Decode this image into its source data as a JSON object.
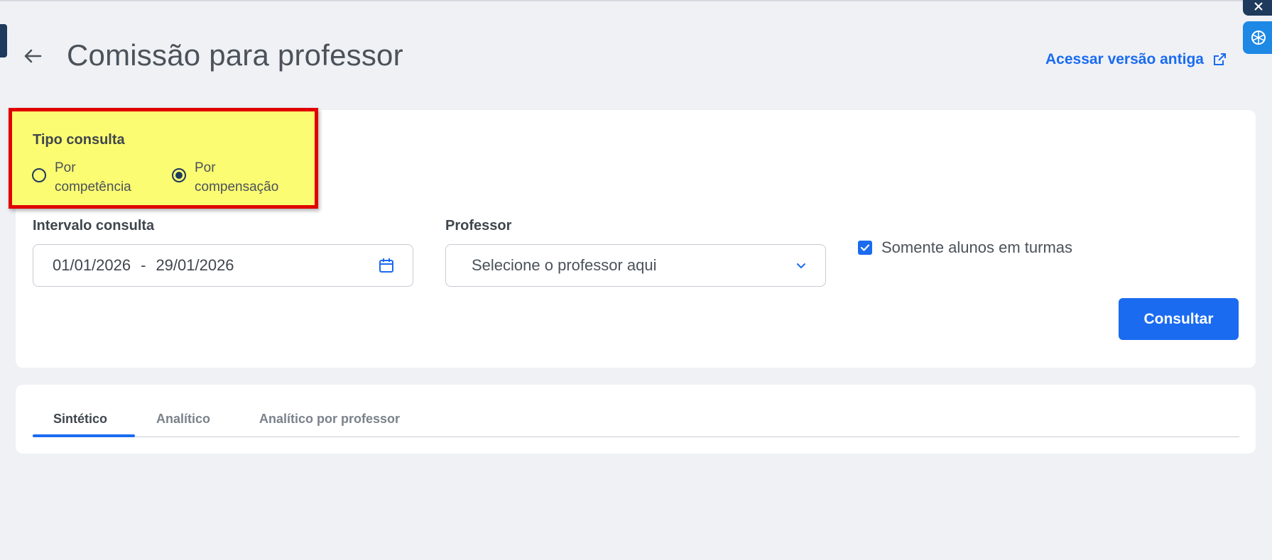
{
  "header": {
    "title": "Comissão para professor",
    "back_icon": "arrow-left-icon",
    "old_version_link": "Acessar versão antiga",
    "old_version_icon": "external-link-icon"
  },
  "filters": {
    "tipo_consulta": {
      "label": "Tipo consulta",
      "options": [
        {
          "label": "Por competência",
          "selected": false
        },
        {
          "label": "Por compensação",
          "selected": true
        }
      ]
    },
    "intervalo": {
      "label": "Intervalo consulta",
      "start": "01/01/2026",
      "separator": "-",
      "end": "29/01/2026",
      "icon": "calendar-icon"
    },
    "professor": {
      "label": "Professor",
      "placeholder": "Selecione o professor aqui",
      "icon": "chevron-down-icon"
    },
    "somente_turmas": {
      "label": "Somente alunos em turmas",
      "checked": true
    },
    "submit_label": "Consultar"
  },
  "tabs": [
    {
      "label": "Sintético",
      "active": true
    },
    {
      "label": "Analítico",
      "active": false
    },
    {
      "label": "Analítico por professor",
      "active": false
    }
  ],
  "colors": {
    "accent": "#1a6bf0",
    "background": "#eff1f5",
    "highlight_fill": "#fcfc72",
    "highlight_border": "#e00000",
    "dark": "#1e3a5c"
  }
}
